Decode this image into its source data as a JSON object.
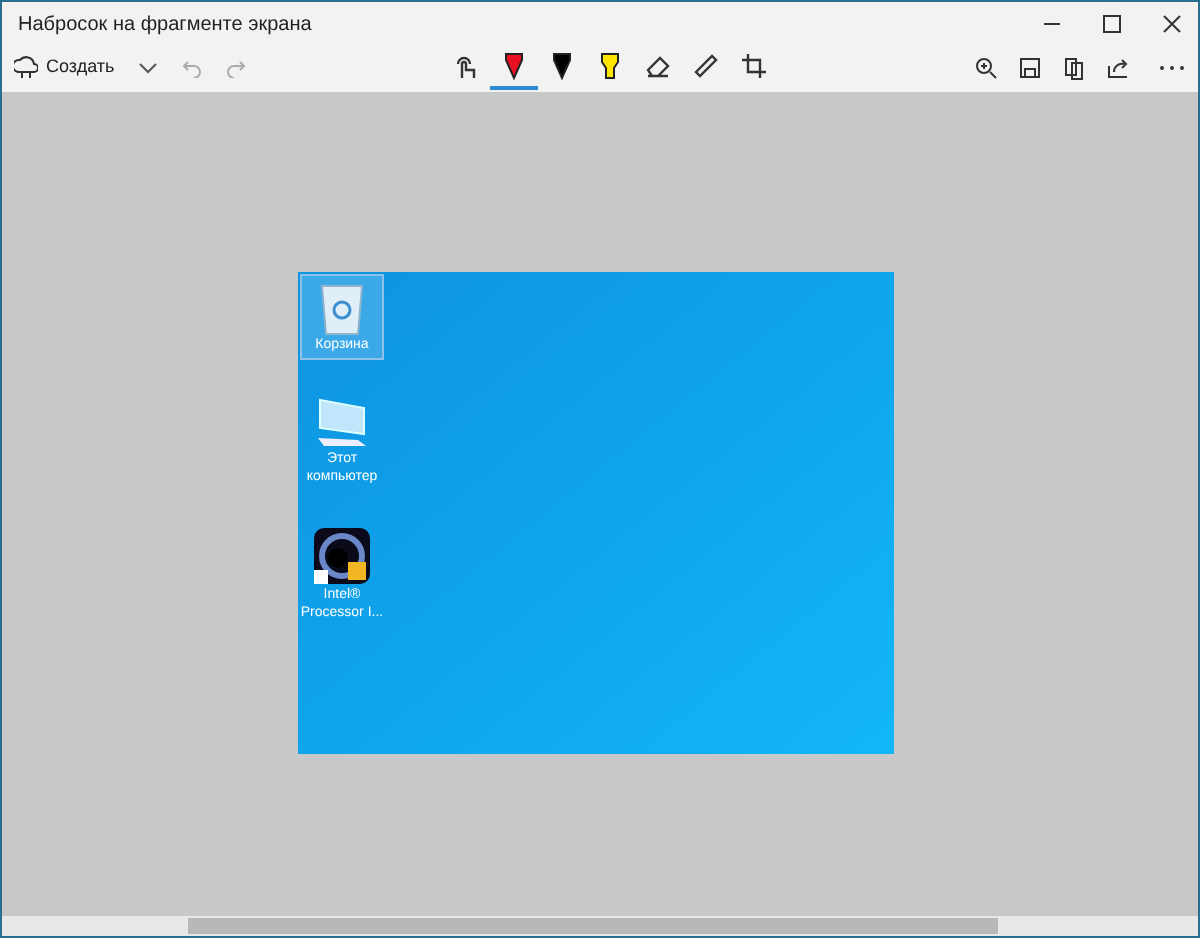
{
  "window": {
    "title": "Набросок на фрагменте экрана"
  },
  "toolbar": {
    "new_button": "Создать",
    "tools": [
      {
        "kind": "touch",
        "selected": false
      },
      {
        "kind": "pen",
        "color": "#e81123",
        "selected": true
      },
      {
        "kind": "pen",
        "color": "#000000",
        "selected": false
      },
      {
        "kind": "highlighter",
        "color": "#ffe600",
        "selected": false
      },
      {
        "kind": "eraser",
        "selected": false
      },
      {
        "kind": "ruler",
        "selected": false
      },
      {
        "kind": "crop",
        "selected": false
      }
    ]
  },
  "desktop_icons": [
    {
      "kind": "bin",
      "label": "Корзина",
      "selected": true
    },
    {
      "kind": "computer",
      "label": "Этот компьютер",
      "selected": false
    },
    {
      "kind": "app",
      "label": "Intel® Processor I...",
      "selected": false
    }
  ]
}
